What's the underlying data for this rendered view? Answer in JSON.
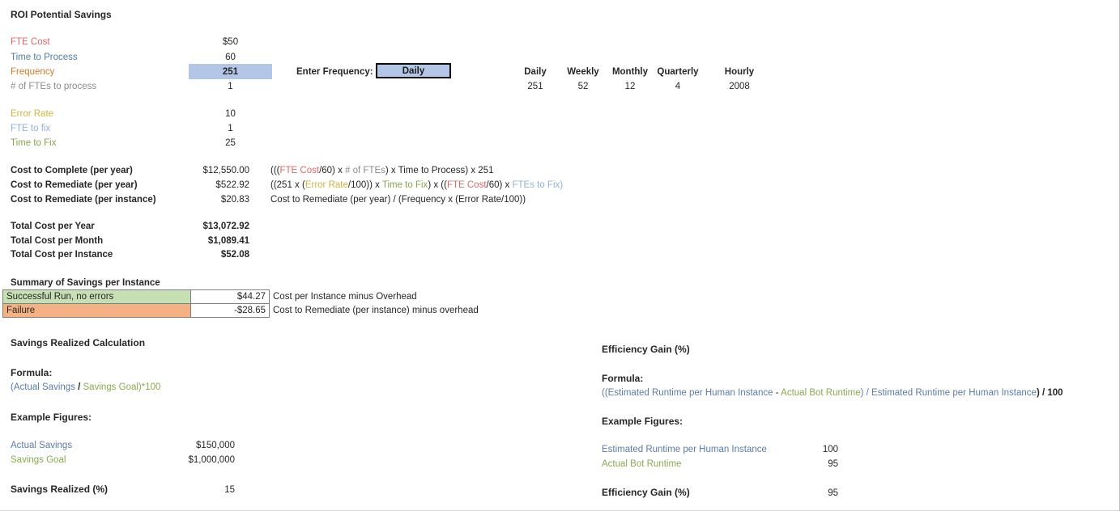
{
  "title": "ROI Potential Savings",
  "inputs": {
    "rows": [
      {
        "label": "FTE Cost",
        "value": "$50"
      },
      {
        "label": "Time to Process",
        "value": "60"
      },
      {
        "label": "Frequency",
        "value": "251"
      },
      {
        "label": "# of FTEs to process",
        "value": "1"
      }
    ],
    "error_rows": [
      {
        "label": "Error Rate",
        "value": "10"
      },
      {
        "label": "FTE to fix",
        "value": "1"
      },
      {
        "label": "Time to Fix",
        "value": "25"
      }
    ]
  },
  "frequency_selector": {
    "label": "Enter Frequency:",
    "selected": "Daily",
    "options": [
      "Daily",
      "Weekly",
      "Monthly",
      "Quarterly",
      "Hourly"
    ]
  },
  "frequency_table": {
    "headers": [
      "Daily",
      "Weekly",
      "Monthly",
      "Quarterly",
      "Hourly"
    ],
    "values": [
      "251",
      "52",
      "12",
      "4",
      "2008"
    ]
  },
  "costs": {
    "rows": [
      {
        "label": "Cost to Complete (per year)",
        "value": "$12,550.00"
      },
      {
        "label": "Cost to Remediate (per year)",
        "value": "$522.92"
      },
      {
        "label": "Cost to Remediate (per instance)",
        "value": "$20.83"
      }
    ],
    "formula1": {
      "p1": "(((",
      "fte_cost": "FTE Cost",
      "p2": "/60) x ",
      "num_ftes": "# of FTEs",
      "p3": ") x ",
      "time_to_process": "Time to Process",
      "p4": ") x 251"
    },
    "formula2": {
      "p1": "((251 x (",
      "error_rate": "Error Rate",
      "p2": "/100)) x ",
      "time_to_fix": "Time to Fix",
      "p3": ") x ((",
      "fte_cost": "FTE Cost",
      "p4": "/60) x ",
      "ftes_to_fix": "FTEs to Fix",
      "p5": ")"
    },
    "formula3": "Cost to Remediate (per year) / (Frequency x (Error Rate/100))"
  },
  "totals": {
    "rows": [
      {
        "label": "Total Cost per Year",
        "value": "$13,072.92"
      },
      {
        "label": "Total Cost per Month",
        "value": "$1,089.41"
      },
      {
        "label": "Total Cost per Instance",
        "value": "$52.08"
      }
    ]
  },
  "summary": {
    "title": "Summary of Savings per Instance",
    "rows": [
      {
        "label": "Successful Run, no errors",
        "value": "$44.27",
        "note": "Cost per Instance minus Overhead"
      },
      {
        "label": "Failure",
        "value": "-$28.65",
        "note": "Cost to Remediate (per instance) minus overhead"
      }
    ]
  },
  "savings_realized": {
    "title": "Savings Realized Calculation",
    "formula_heading": "Formula:",
    "formula": {
      "p1": "(",
      "actual_savings": "Actual Savings",
      "p2": " / ",
      "savings_goal": "Savings Goal",
      "p3": ")*100"
    },
    "example_heading": "Example Figures:",
    "figures": [
      {
        "label": "Actual Savings",
        "value": "$150,000"
      },
      {
        "label": "Savings Goal",
        "value": "$1,000,000"
      }
    ],
    "result": {
      "label": "Savings Realized (%)",
      "value": "15"
    }
  },
  "efficiency_gain": {
    "title": "Efficiency Gain (%)",
    "formula_heading": "Formula:",
    "formula": {
      "p1": "((",
      "est_runtime": "Estimated Runtime per Human Instance",
      "p2": " - ",
      "bot_runtime": "Actual Bot Runtime",
      "p3": ") / ",
      "est_runtime2": "Estimated Runtime per Human Instance",
      "p4": ") / 100"
    },
    "example_heading": "Example Figures:",
    "figures": [
      {
        "label": "Estimated Runtime per Human Instance",
        "value": "100"
      },
      {
        "label": "Actual Bot Runtime",
        "value": "95"
      }
    ],
    "result": {
      "label": "Efficiency Gain (%)",
      "value": "95"
    }
  },
  "colors": {
    "fte_cost": "#e06666",
    "time_to_process": "#4f7da6",
    "frequency": "#d07a28",
    "num_ftes": "#8c8c8c",
    "error_rate": "#d4b441",
    "fte_to_fix": "#8db3d9",
    "time_to_fix": "#87a54c",
    "highlight": "#b3c6e7",
    "success_row": "#c6e0b4",
    "failure_row": "#f4b183"
  }
}
